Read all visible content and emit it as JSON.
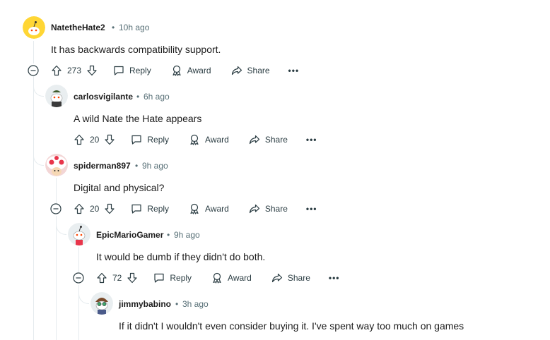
{
  "comments": [
    {
      "username": "NatetheHate2",
      "time": "10h ago",
      "body": "It has backwards compatibility support.",
      "votes": "273",
      "avatar": "snoo-yellow-avatar"
    },
    {
      "username": "carlosvigilante",
      "time": "6h ago",
      "body": "A wild Nate the Hate appears",
      "votes": "20",
      "avatar": "snoo-bowtie-avatar"
    },
    {
      "username": "spiderman897",
      "time": "9h ago",
      "body": "Digital and physical?",
      "votes": "20",
      "avatar": "toad-avatar"
    },
    {
      "username": "EpicMarioGamer",
      "time": "9h ago",
      "body": "It would be dumb if they didn't do both.",
      "votes": "72",
      "avatar": "snoo-red-avatar"
    },
    {
      "username": "jimmybabino",
      "time": "3h ago",
      "body": "If it didn't I wouldn't even consider buying it. I've spent way too much on games",
      "avatar": "snoo-goggles-avatar"
    }
  ],
  "actions": {
    "reply": "Reply",
    "award": "Award",
    "share": "Share",
    "more": "•••"
  },
  "separator": "•",
  "colors": {
    "thread_line": "#e5ebee",
    "meta_text": "#576f76",
    "action_text": "#2a3c42"
  }
}
